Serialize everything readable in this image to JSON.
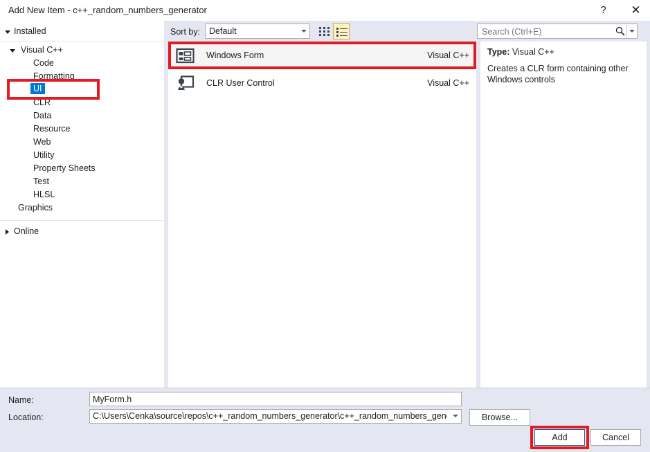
{
  "window": {
    "title": "Add New Item - c++_random_numbers_generator",
    "help_label": "?",
    "close_label": "✕"
  },
  "toolbar": {
    "sort_by_label": "Sort by:",
    "sort_by_value": "Default",
    "view_tiles_icon": "tiles-view-icon",
    "view_list_icon": "list-view-icon"
  },
  "search": {
    "placeholder": "Search (Ctrl+E)",
    "value": "",
    "icon": "search-icon"
  },
  "sidebar": {
    "installed_label": "Installed",
    "online_label": "Online",
    "items": [
      {
        "label": "Visual C++",
        "level": 0,
        "expander": "down",
        "selected": false
      },
      {
        "label": "Code",
        "level": 1,
        "selected": false
      },
      {
        "label": "Formatting",
        "level": 1,
        "selected": false
      },
      {
        "label": "UI",
        "level": 1,
        "selected": true
      },
      {
        "label": "CLR",
        "level": 1,
        "selected": false
      },
      {
        "label": "Data",
        "level": 1,
        "selected": false
      },
      {
        "label": "Resource",
        "level": 1,
        "selected": false
      },
      {
        "label": "Web",
        "level": 1,
        "selected": false
      },
      {
        "label": "Utility",
        "level": 1,
        "selected": false
      },
      {
        "label": "Property Sheets",
        "level": 1,
        "selected": false
      },
      {
        "label": "Test",
        "level": 1,
        "selected": false
      },
      {
        "label": "HLSL",
        "level": 1,
        "selected": false
      },
      {
        "label": "Graphics",
        "level": 0,
        "expander": "none",
        "selected": false
      }
    ]
  },
  "templates": [
    {
      "name": "Windows Form",
      "language": "Visual C++",
      "icon": "windows-form-icon",
      "selected": true
    },
    {
      "name": "CLR User Control",
      "language": "Visual C++",
      "icon": "clr-user-control-icon",
      "selected": false
    }
  ],
  "details": {
    "type_label": "Type:",
    "type_value": "Visual C++",
    "description": "Creates a CLR form containing other Windows controls"
  },
  "fields": {
    "name_label": "Name:",
    "name_value": "MyForm.h",
    "location_label": "Location:",
    "location_value": "C:\\Users\\Cenka\\source\\repos\\c++_random_numbers_generator\\c++_random_numbers_generator"
  },
  "buttons": {
    "browse": "Browse...",
    "add": "Add",
    "cancel": "Cancel"
  },
  "annotations": {
    "color": "#e01b24",
    "highlighted": [
      "sidebar-item-ui",
      "template-windows-form",
      "add-button"
    ]
  },
  "colors": {
    "accent_selection": "#0078d7",
    "dialog_background": "#e4e7f1",
    "panel_background": "#ffffff",
    "annotation_red": "#e01b24",
    "toolbar_active": "#fdf4bf"
  }
}
